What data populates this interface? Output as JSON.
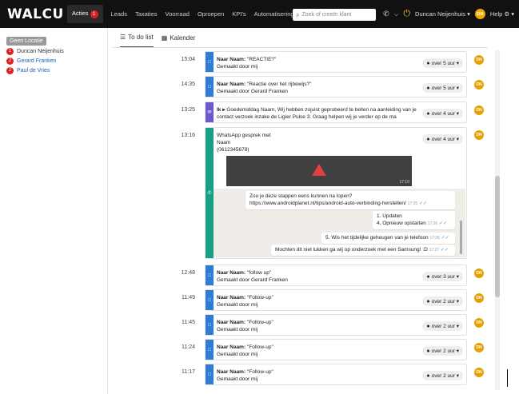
{
  "nav": {
    "logo": "WALCU",
    "items": [
      {
        "label": "Acties",
        "badge": "1",
        "active": true
      },
      {
        "label": "Leads"
      },
      {
        "label": "Taxaties"
      },
      {
        "label": "Voorraad"
      },
      {
        "label": "Oproepen"
      },
      {
        "label": "KPI's"
      },
      {
        "label": "Automatisering"
      }
    ],
    "search_placeholder": "Zoek of creeër klant",
    "user_name": "Duncan Neijenhuis",
    "user_initials": "DN",
    "help_label": "Help"
  },
  "sidebar": {
    "header": "Geen Locatie",
    "items": [
      {
        "badge": "1",
        "label": "Duncan Neijenhuis"
      },
      {
        "badge": "2",
        "label": "Gerard Franken"
      },
      {
        "badge": "2",
        "label": "Paul de Vries"
      }
    ]
  },
  "tabs": [
    {
      "label": "To do list",
      "icon": "list-icon"
    },
    {
      "label": "Kalender",
      "icon": "calendar-icon"
    }
  ],
  "tasks": [
    {
      "time": "15:04",
      "title": "Naar Naam:",
      "subject": "\"REACTIE?\"",
      "sub": "Gemaakt door mij",
      "due": "over 5 uur",
      "type": "blue"
    },
    {
      "time": "14:35",
      "title": "Naar Naam:",
      "subject": "\"Reactie over het rijbewijs?\"",
      "sub": "Gemaakt door Gerard Franken",
      "due": "over 5 uur",
      "type": "blue"
    },
    {
      "time": "13:25",
      "title": "Ik ▸",
      "subject": "Goedemiddag Naam, Wij hebben zojuist geprobeerd te bellen na aanleiding van je",
      "sub": "contact verzoek inzake de Ligier Pulse 3. Graag helpen wij je verder op de ma",
      "due": "over 4 uur",
      "type": "purple"
    },
    {
      "time": "12:48",
      "title": "Naar Naam:",
      "subject": "\"follow up\"",
      "sub": "Gemaakt door Gerard Franken",
      "due": "over 3 uur",
      "type": "blue"
    },
    {
      "time": "11:49",
      "title": "Naar Naam:",
      "subject": "\"Follow-up\"",
      "sub": "Gemaakt door mij",
      "due": "over 2 uur",
      "type": "blue"
    },
    {
      "time": "11:45",
      "title": "Naar Naam:",
      "subject": "\"Follow-up\"",
      "sub": "Gemaakt door mij",
      "due": "over 2 uur",
      "type": "blue"
    },
    {
      "time": "11:24",
      "title": "Naar Naam:",
      "subject": "\"Follow-up\"",
      "sub": "Gemaakt door mij",
      "due": "over 2 uur",
      "type": "blue"
    },
    {
      "time": "11:17",
      "title": "Naar Naam:",
      "subject": "\"Follow-up\"",
      "sub": "Gemaakt door mij",
      "due": "over 2 uur",
      "type": "blue"
    }
  ],
  "whatsapp": {
    "time": "13:16",
    "header_line1": "WhatsApp gesprek met",
    "header_line2": "Naam",
    "header_line3": "(0612345678)",
    "due": "over 4 uur",
    "image_time": "17:10",
    "messages": [
      {
        "line1": "Zou je deze stappen eens kunnen na lopen?",
        "line2": "https://www.androidplanet.nl/tips/android-auto-verbinding-herstellen/",
        "time": "17:25"
      },
      {
        "line1": "1. Updaten",
        "line2": "4. Opnieuw opstarten",
        "time": "17:26"
      },
      {
        "line1": "5. Wis het tijdelijke geheugen van je telefoon",
        "time": "17:26"
      },
      {
        "line1": "Mochten dit niet lukken ga wij op onderzoek met een Samsung! :D",
        "time": "17:27"
      }
    ]
  },
  "avatar_initials": "DN"
}
